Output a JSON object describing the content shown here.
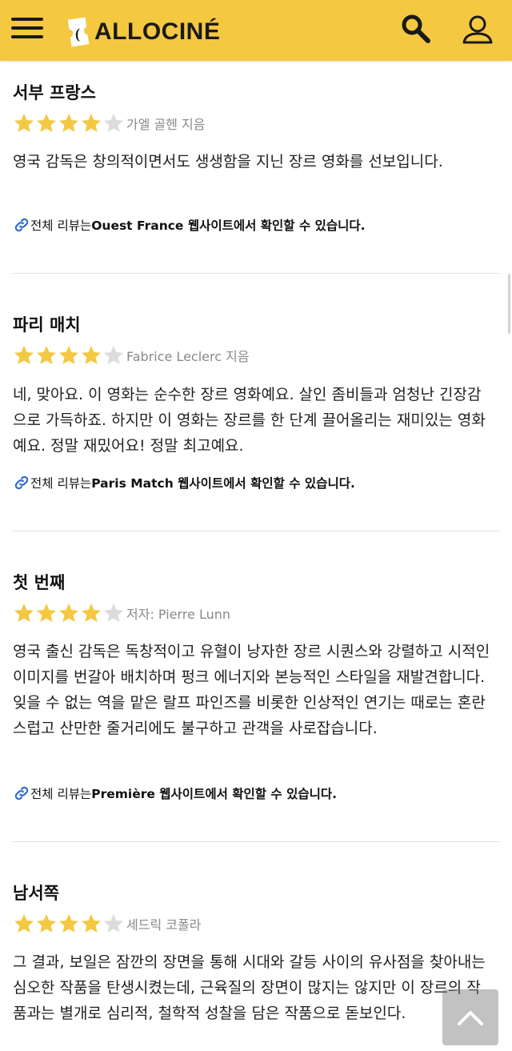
{
  "header": {
    "logo_text": "ALLOCINÉ",
    "brand_color": "#f5c842",
    "icons": [
      "menu-icon",
      "search-icon",
      "user-icon"
    ]
  },
  "star_colors": {
    "filled": "#f5c842",
    "empty": "#dcdcdc"
  },
  "reviews": [
    {
      "title": "서부 프랑스",
      "rating": 4,
      "max_rating": 5,
      "author": "가엘 골헨 지음",
      "body": "영국 감독은 창의적이면서도 생생함을 지닌 장르 영화를 선보입니다.",
      "link_prefix": "전체 리뷰는 ",
      "link_bold": "Ouest France 웹사이트에서 확인할 수 있습니다."
    },
    {
      "title": "파리 매치",
      "rating": 4,
      "max_rating": 5,
      "author": "Fabrice Leclerc 지음",
      "body": "네, 맞아요. 이 영화는 순수한 장르 영화예요. 살인 좀비들과 엄청난 긴장감으로 가득하죠. 하지만 이 영화는 장르를 한 단계 끌어올리는 재미있는 영화예요. 정말 재밌어요! 정말 최고예요.",
      "link_prefix": "전체 리뷰는 ",
      "link_bold": "Paris Match 웹사이트에서 확인할 수 있습니다."
    },
    {
      "title": "첫 번째",
      "rating": 4,
      "max_rating": 5,
      "author": "저자: Pierre Lunn",
      "body": "영국 출신 감독은 독창적이고 유혈이 낭자한 장르 시퀀스와 강렬하고 시적인 이미지를 번갈아 배치하며 펑크 에너지와 본능적인 스타일을 재발견합니다. 잊을 수 없는 역을 맡은 랄프 파인즈를 비롯한 인상적인 연기는 때로는 혼란스럽고 산만한 줄거리에도 불구하고 관객을 사로잡습니다.",
      "link_prefix": "전체 리뷰는 ",
      "link_bold": "Première 웹사이트에서 확인할 수 있습니다."
    },
    {
      "title": "남서쪽",
      "rating": 4,
      "max_rating": 5,
      "author": "세드릭 코폴라",
      "body": "그 결과, 보일은 잠깐의 장면을 통해 시대와 갈등 사이의 유사점을 찾아내는 심오한 작품을 탄생시켰는데, 근육질의 장면이 많지는 않지만 이 장르의 작품과는 별개로 심리적, 철학적 성찰을 담은 작품으로 돋보인다."
    }
  ]
}
